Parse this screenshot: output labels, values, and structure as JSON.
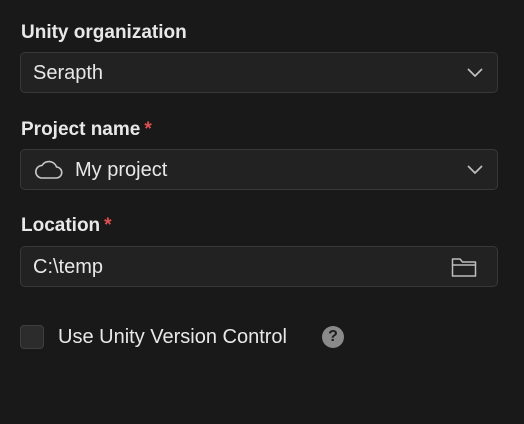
{
  "organization": {
    "label": "Unity organization",
    "value": "Serapth",
    "icon": "chevron-down-icon"
  },
  "project_name": {
    "label": "Project name",
    "required_mark": "*",
    "value": "My project",
    "icon": "cloud-icon",
    "dropdown_icon": "chevron-down-icon"
  },
  "location": {
    "label": "Location",
    "required_mark": "*",
    "value": "C:\\temp",
    "icon": "folder-icon"
  },
  "version_control": {
    "label": "Use Unity Version Control",
    "checked": false,
    "help_glyph": "?"
  },
  "colors": {
    "background": "#191919",
    "field": "#222222",
    "required": "#e2504f"
  }
}
